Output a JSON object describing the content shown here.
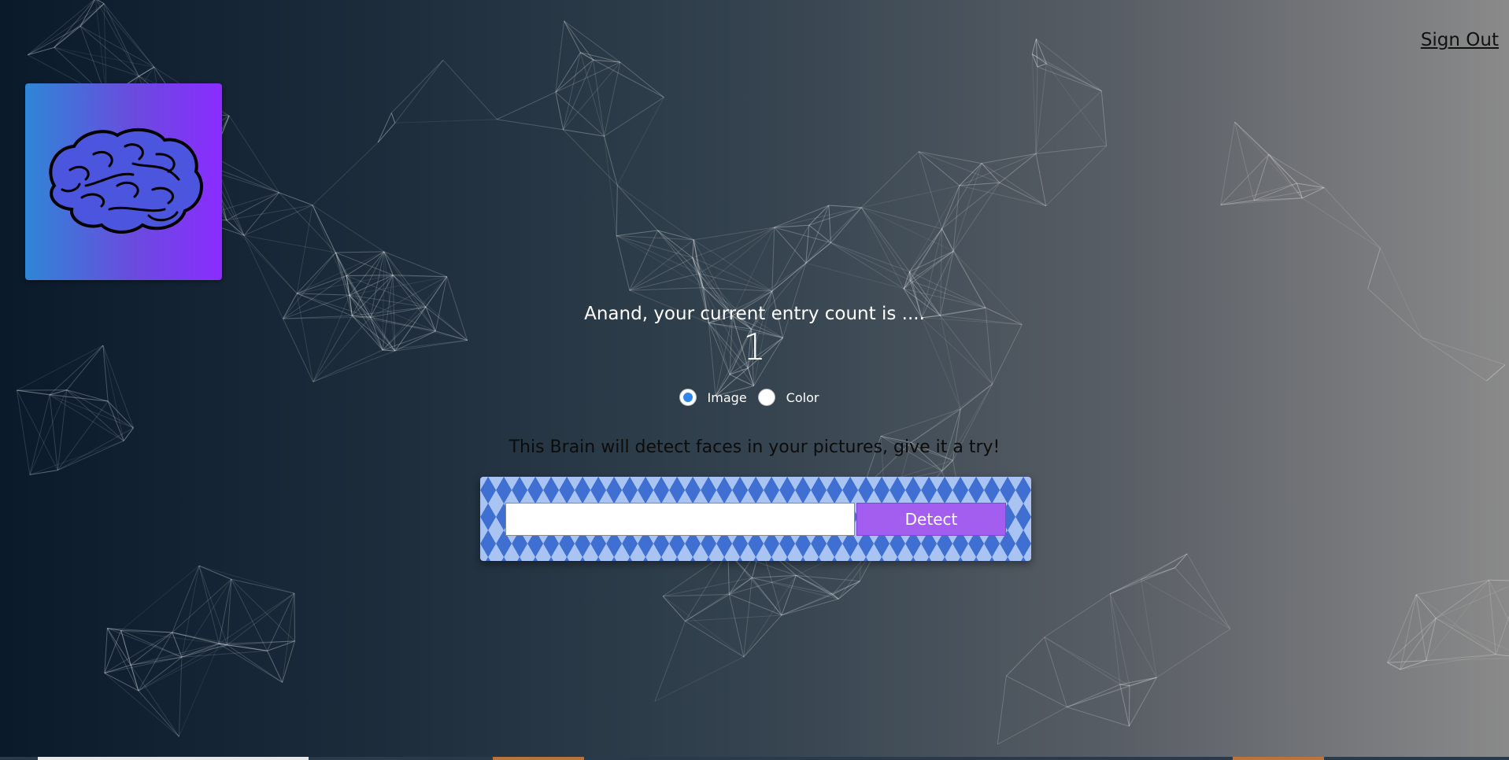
{
  "nav": {
    "sign_out_label": "Sign Out"
  },
  "logo": {
    "icon": "brain-icon"
  },
  "rank": {
    "message": "Anand, your current entry count is ....",
    "count": "1"
  },
  "mode": {
    "options": [
      {
        "label": "Image",
        "selected": true
      },
      {
        "label": "Color",
        "selected": false
      }
    ]
  },
  "form": {
    "description": "This Brain will detect faces in your pictures, give it a try!",
    "input_value": "",
    "button_label": "Detect"
  },
  "colors": {
    "accent_button": "#a35ef0",
    "radio_selected": "#2f86e8",
    "logo_gradient_start": "#2f86d6",
    "logo_gradient_end": "#8a2cff"
  }
}
